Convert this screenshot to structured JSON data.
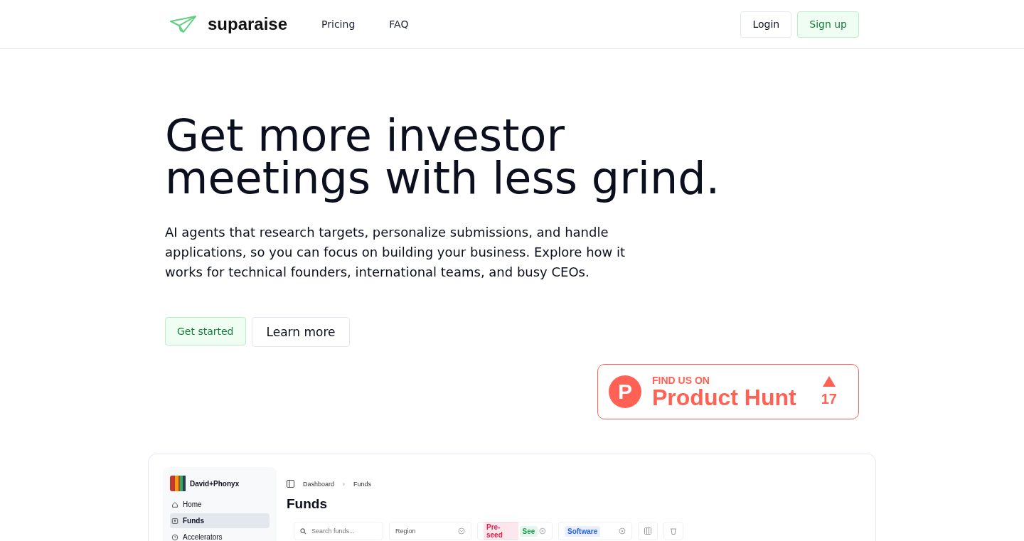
{
  "header": {
    "brand": "suparaise",
    "nav": [
      "Pricing",
      "FAQ"
    ],
    "login": "Login",
    "signup": "Sign up"
  },
  "hero": {
    "title_lines": [
      "Get more investor",
      "meetings with less grind."
    ],
    "text": "AI agents that research targets, personalize submissions, and handle applications, so you can focus on building your business. Explore how it works for technical founders, international teams, and busy CEOs.",
    "primary": "Get started",
    "secondary": "Learn more"
  },
  "badge": {
    "eyebrow": "FIND US ON",
    "name": "Product Hunt",
    "letter": "P",
    "votes": "17"
  },
  "preview": {
    "workspace": "David+Phonyx",
    "sidebar": [
      {
        "label": "Home",
        "selected": false
      },
      {
        "label": "Funds",
        "selected": true
      },
      {
        "label": "Accelerators",
        "selected": false
      }
    ],
    "breadcrumb": [
      "Dashboard",
      "Funds"
    ],
    "separator": "›",
    "heading": "Funds",
    "search_placeholder": "Search funds...",
    "region": "Region",
    "stage_tags": [
      {
        "label": "Pre-seed",
        "color": "#e11d48"
      },
      {
        "label": "See",
        "color": "#16a34a"
      }
    ],
    "industry_tags": [
      {
        "label": "Software",
        "color": "#2563eb"
      }
    ]
  }
}
